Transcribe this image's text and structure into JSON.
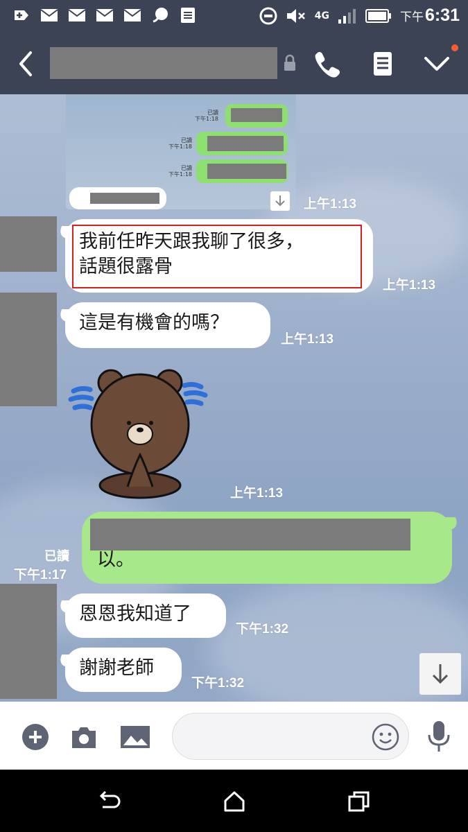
{
  "status_bar": {
    "network": "4G",
    "time_prefix": "下午",
    "time": "6:31",
    "icons": [
      "add-box-icon",
      "mail-icon",
      "mail-icon",
      "mail-icon",
      "mail-icon",
      "chat-bubble-icon",
      "document-icon",
      "do-not-disturb-icon",
      "mute-icon",
      "signal-icon",
      "battery-icon"
    ]
  },
  "header": {
    "icons": [
      "back-icon",
      "lock-icon",
      "phone-icon",
      "notes-icon",
      "dropdown-icon"
    ]
  },
  "messages": {
    "image_time": "上午1:13",
    "msg1_line1": "我前任昨天跟我聊了很多，",
    "msg1_line2": "話題很露骨",
    "msg1_time": "上午1:13",
    "msg2": "這是有機會的嗎？",
    "msg2_time": "上午1:13",
    "sticker_time": "上午1:13",
    "sent_text": "以。",
    "sent_read": "已讀",
    "sent_time": "下午1:17",
    "msg3": "恩恩我知道了",
    "msg3_time": "下午1:32",
    "msg4": "謝謝老師",
    "msg4_time": "下午1:32"
  },
  "input_bar": {
    "icons": [
      "plus-icon",
      "camera-icon",
      "image-icon",
      "emoji-icon",
      "mic-icon"
    ]
  },
  "nav_bar": {
    "icons": [
      "nav-back-icon",
      "home-icon",
      "recents-icon"
    ]
  },
  "colors": {
    "header_bg": "#3c4354",
    "sent_bubble": "#a7e88a",
    "highlight": "#d91c1c"
  }
}
